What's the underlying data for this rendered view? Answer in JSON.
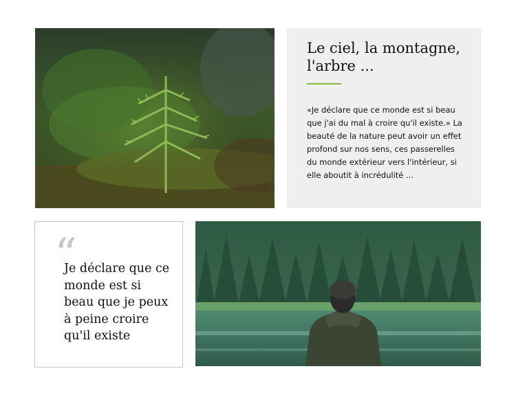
{
  "hero": {
    "title": "Le ciel, la montagne, l'arbre ...",
    "body": "«Je déclare que ce monde est si beau que j'ai du mal à croire qu'il existe.» La beauté de la nature peut avoir un effet profond sur nos sens, ces passerelles du monde extérieur vers l'intérieur, si elle aboutit à incrédulité ...",
    "accent_color": "#7dbb3a"
  },
  "quote": {
    "mark": "“",
    "text": "Je déclare que ce monde est si beau que je peux à peine croire qu'il existe"
  },
  "images": {
    "moss": "forest-seedling-photo",
    "lake": "person-by-lake-photo"
  }
}
